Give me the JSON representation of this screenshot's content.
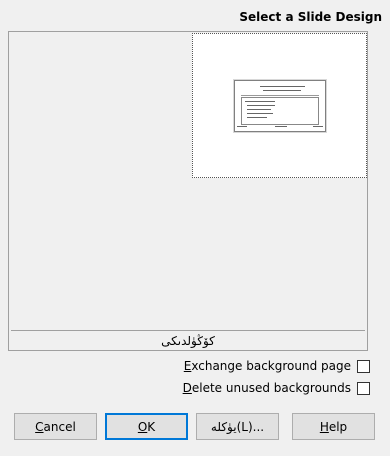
{
  "dialog": {
    "title": "Select a Slide Design"
  },
  "design_list": {
    "selected_name": "كۆڭۈلدىكى"
  },
  "options": {
    "exchange_background_page": {
      "mnemonic": "E",
      "rest": "xchange background page",
      "checked": false
    },
    "delete_unused_backgrounds": {
      "mnemonic": "D",
      "rest": "elete unused backgrounds",
      "checked": false
    }
  },
  "buttons": {
    "cancel": {
      "mnemonic": "C",
      "rest": "ancel"
    },
    "ok": {
      "mnemonic": "O",
      "rest": "K"
    },
    "load": {
      "label": "يۈكلە(L)..."
    },
    "help": {
      "mnemonic": "H",
      "rest": "elp"
    }
  }
}
